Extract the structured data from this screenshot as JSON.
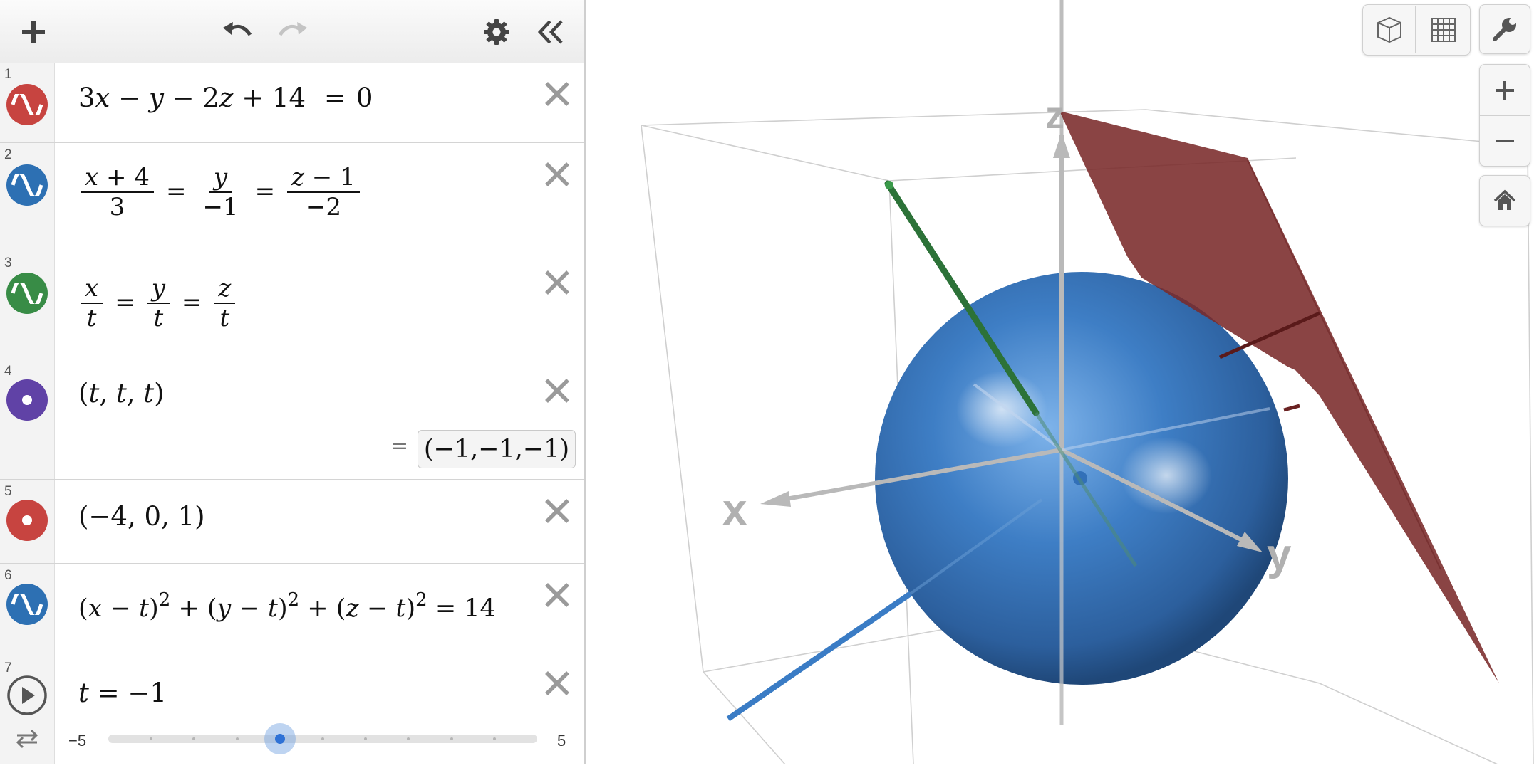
{
  "toolbar": {
    "add_icon": "plus-icon",
    "undo_icon": "undo-icon",
    "redo_icon": "redo-icon",
    "settings_icon": "gear-icon",
    "collapse_icon": "double-chevron-left-icon"
  },
  "expressions": [
    {
      "num": "1",
      "color": "#c74440",
      "icon": "wave-icon"
    },
    {
      "num": "2",
      "color": "#2d70b3",
      "icon": "wave-icon"
    },
    {
      "num": "3",
      "color": "#388c46",
      "icon": "wave-icon"
    },
    {
      "num": "4",
      "color": "#6042a6",
      "icon": "point-icon",
      "result": "(−1,−1,−1)",
      "result_prefix": "="
    },
    {
      "num": "5",
      "color": "#c74440",
      "icon": "point-icon"
    },
    {
      "num": "6",
      "color": "#2d70b3",
      "icon": "wave-icon"
    },
    {
      "num": "7",
      "icon": "play-icon",
      "slider": {
        "min": "−5",
        "max": "5",
        "value": -1,
        "min_value": -5,
        "max_value": 5
      }
    }
  ],
  "colors": {
    "red": "#c74440",
    "blue": "#2d70b3",
    "green": "#388c46",
    "purple": "#6042a6",
    "plane": "#7a2a2a",
    "sphere": "#3f7fc4"
  },
  "graph": {
    "axis_x": "x",
    "axis_y": "y",
    "axis_z": "z",
    "controls": [
      "cube-icon",
      "grid-icon",
      "wrench-icon",
      "zoom-in-icon",
      "zoom-out-icon",
      "home-icon"
    ]
  }
}
